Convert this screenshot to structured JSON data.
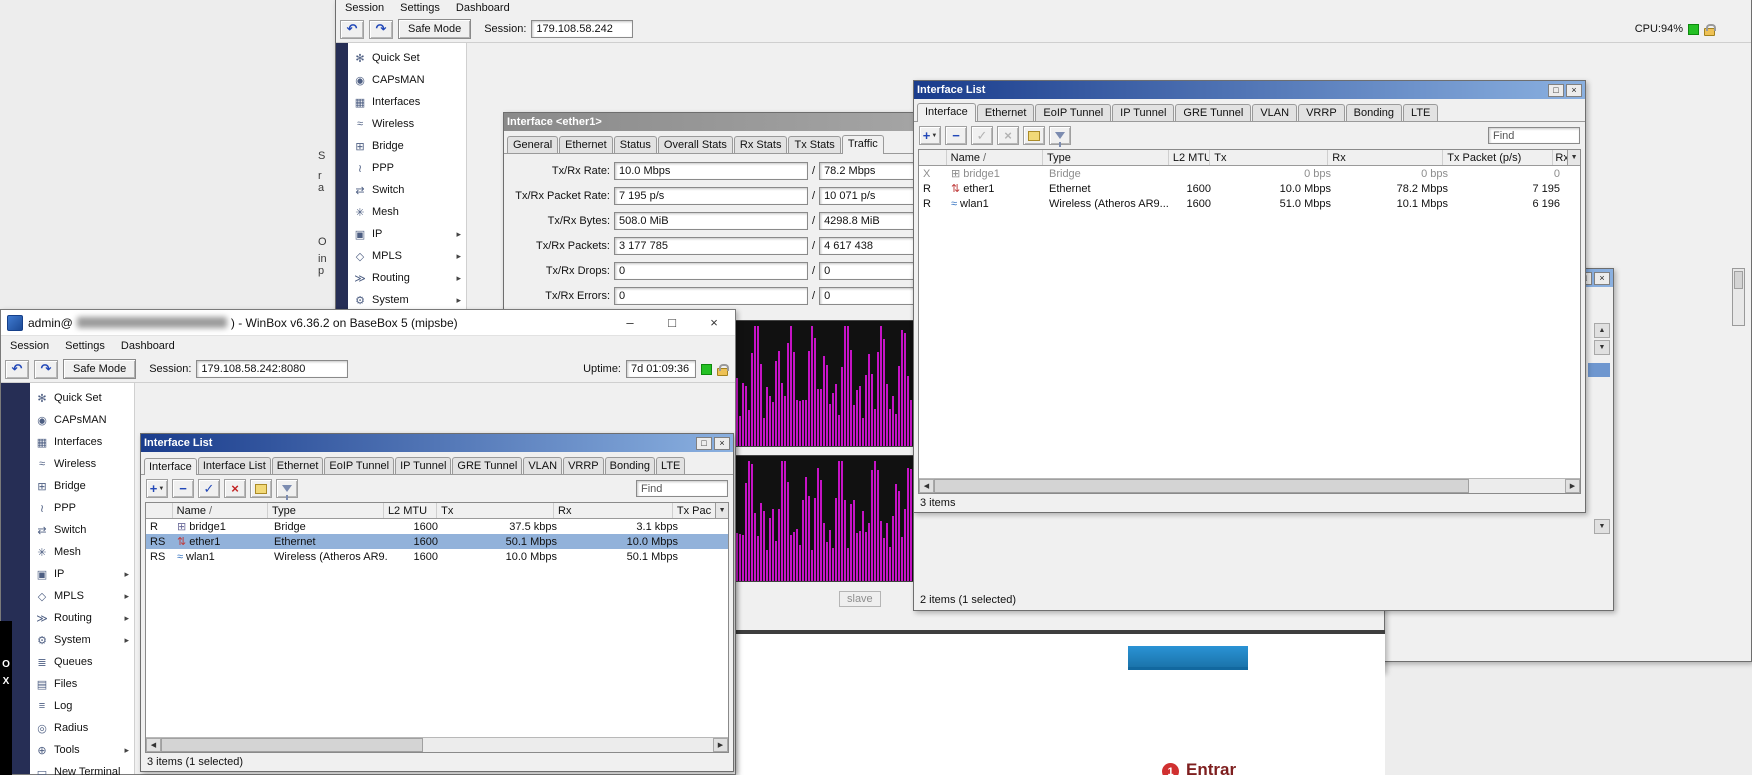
{
  "colors": {
    "title_active_a": "#1a3c8c",
    "title_active_b": "#8ab0e0",
    "title_inactive_a": "#8a8a8a",
    "title_inactive_b": "#c2c2c2",
    "selection": "#92b2da",
    "graph_bar": "#c613c6",
    "accent_strip": "#262e55",
    "cpu_green": "#24c024",
    "web_blue": "#2a93d5",
    "entrar_red": "#7e1f1f"
  },
  "icons": {
    "undo": "↶",
    "redo": "↷",
    "submenu": "▸",
    "dropdown": "▼",
    "sort": "/",
    "left": "◀",
    "right": "▶",
    "up": "▲",
    "down": "▼",
    "minimize": "–",
    "maximize": "□",
    "close": "×",
    "plus": "+",
    "minus": "−",
    "check": "✓",
    "cross": "×"
  },
  "desktop_fragments": {
    "col1": [
      "S",
      "r",
      "a"
    ],
    "col2": [
      "O",
      "in",
      "p"
    ]
  },
  "winbox_top": {
    "menu": [
      "Session",
      "Settings",
      "Dashboard"
    ],
    "safe_mode": "Safe Mode",
    "session_label": "Session:",
    "session_value": "179.108.58.242",
    "cpu": "CPU:94%",
    "sidebar": [
      {
        "icon": "✻",
        "label": "Quick Set"
      },
      {
        "icon": "◉",
        "label": "CAPsMAN"
      },
      {
        "icon": "▦",
        "label": "Interfaces"
      },
      {
        "icon": "≈",
        "label": "Wireless"
      },
      {
        "icon": "⊞",
        "label": "Bridge"
      },
      {
        "icon": "≀",
        "label": "PPP"
      },
      {
        "icon": "⇄",
        "label": "Switch"
      },
      {
        "icon": "✳",
        "label": "Mesh"
      },
      {
        "icon": "▣",
        "label": "IP"
      },
      {
        "icon": "◇",
        "label": "MPLS"
      },
      {
        "icon": "≫",
        "label": "Routing"
      },
      {
        "icon": "⚙",
        "label": "System"
      }
    ]
  },
  "ether1_window": {
    "title": "Interface <ether1>",
    "tabs": [
      "General",
      "Ethernet",
      "Status",
      "Overall Stats",
      "Rx Stats",
      "Tx Stats",
      "Traffic"
    ],
    "active_tab": "Traffic",
    "separator": "/",
    "fields": [
      {
        "label": "Tx/Rx Rate:",
        "tx": "10.0 Mbps",
        "rx": "78.2 Mbps"
      },
      {
        "label": "Tx/Rx Packet Rate:",
        "tx": "7 195 p/s",
        "rx": "10 071 p/s"
      },
      {
        "label": "Tx/Rx Bytes:",
        "tx": "508.0 MiB",
        "rx": "4298.8 MiB"
      },
      {
        "label": "Tx/Rx Packets:",
        "tx": "3 177 785",
        "rx": "4 617 438"
      },
      {
        "label": "Tx/Rx Drops:",
        "tx": "0",
        "rx": "0"
      },
      {
        "label": "Tx/Rx Errors:",
        "tx": "0",
        "rx": "0"
      }
    ],
    "slave_label": "slave"
  },
  "interface_list_right": {
    "title": "Interface List",
    "tabs": [
      "Interface",
      "Ethernet",
      "EoIP Tunnel",
      "IP Tunnel",
      "GRE Tunnel",
      "VLAN",
      "VRRP",
      "Bonding",
      "LTE"
    ],
    "active_tab": "Interface",
    "find_label": "Find",
    "columns": [
      "Name",
      "Type",
      "L2 MTU",
      "Tx",
      "Rx",
      "Tx Packet (p/s)",
      "Rx"
    ],
    "rows": [
      {
        "flags": "X",
        "icon": "⊞",
        "name": "bridge1",
        "type": "Bridge",
        "l2mtu": "",
        "tx": "0 bps",
        "rx": "0 bps",
        "tx_packet": "0"
      },
      {
        "flags": "R",
        "icon": "⇅",
        "name": "ether1",
        "type": "Ethernet",
        "l2mtu": "1600",
        "tx": "10.0 Mbps",
        "rx": "78.2 Mbps",
        "tx_packet": "7 195"
      },
      {
        "flags": "R",
        "icon": "≈",
        "name": "wlan1",
        "type": "Wireless (Atheros AR9...",
        "l2mtu": "1600",
        "tx": "51.0 Mbps",
        "rx": "10.1 Mbps",
        "tx_packet": "6 196"
      }
    ],
    "status": "3 items"
  },
  "behind_window": {
    "status": "2 items (1 selected)"
  },
  "winbox_front": {
    "title_prefix": "admin@",
    "title_suffix": ") - WinBox v6.36.2 on BaseBox 5 (mipsbe)",
    "menu": [
      "Session",
      "Settings",
      "Dashboard"
    ],
    "safe_mode": "Safe Mode",
    "session_label": "Session:",
    "session_value": "179.108.58.242:8080",
    "uptime_label": "Uptime:",
    "uptime_value": "7d 01:09:36",
    "vertical_text": [
      "O",
      "X"
    ],
    "sidebar": [
      {
        "icon": "✻",
        "label": "Quick Set"
      },
      {
        "icon": "◉",
        "label": "CAPsMAN"
      },
      {
        "icon": "▦",
        "label": "Interfaces"
      },
      {
        "icon": "≈",
        "label": "Wireless"
      },
      {
        "icon": "⊞",
        "label": "Bridge"
      },
      {
        "icon": "≀",
        "label": "PPP"
      },
      {
        "icon": "⇄",
        "label": "Switch"
      },
      {
        "icon": "✳",
        "label": "Mesh"
      },
      {
        "icon": "▣",
        "label": "IP"
      },
      {
        "icon": "◇",
        "label": "MPLS"
      },
      {
        "icon": "≫",
        "label": "Routing"
      },
      {
        "icon": "⚙",
        "label": "System"
      },
      {
        "icon": "≣",
        "label": "Queues"
      },
      {
        "icon": "▤",
        "label": "Files"
      },
      {
        "icon": "≡",
        "label": "Log"
      },
      {
        "icon": "◎",
        "label": "Radius"
      },
      {
        "icon": "⊕",
        "label": "Tools"
      },
      {
        "icon": "▭",
        "label": "New Terminal"
      }
    ]
  },
  "interface_list_front": {
    "title": "Interface List",
    "tabs": [
      "Interface",
      "Interface List",
      "Ethernet",
      "EoIP Tunnel",
      "IP Tunnel",
      "GRE Tunnel",
      "VLAN",
      "VRRP",
      "Bonding",
      "LTE"
    ],
    "active_tab": "Interface",
    "find_label": "Find",
    "columns": [
      "Name",
      "Type",
      "L2 MTU",
      "Tx",
      "Rx",
      "Tx Pac"
    ],
    "rows": [
      {
        "flags": "R",
        "icon": "⊞",
        "name": "bridge1",
        "type": "Bridge",
        "l2mtu": "1600",
        "tx": "37.5 kbps",
        "rx": "3.1 kbps"
      },
      {
        "flags": "RS",
        "icon": "⇅",
        "name": "ether1",
        "type": "Ethernet",
        "l2mtu": "1600",
        "tx": "50.1 Mbps",
        "rx": "10.0 Mbps"
      },
      {
        "flags": "RS",
        "icon": "≈",
        "name": "wlan1",
        "type": "Wireless (Atheros AR9...",
        "l2mtu": "1600",
        "tx": "10.0 Mbps",
        "rx": "50.1 Mbps"
      }
    ],
    "status": "3 items (1 selected)"
  },
  "webpage": {
    "badge": "1",
    "link_label": "Entrar"
  }
}
